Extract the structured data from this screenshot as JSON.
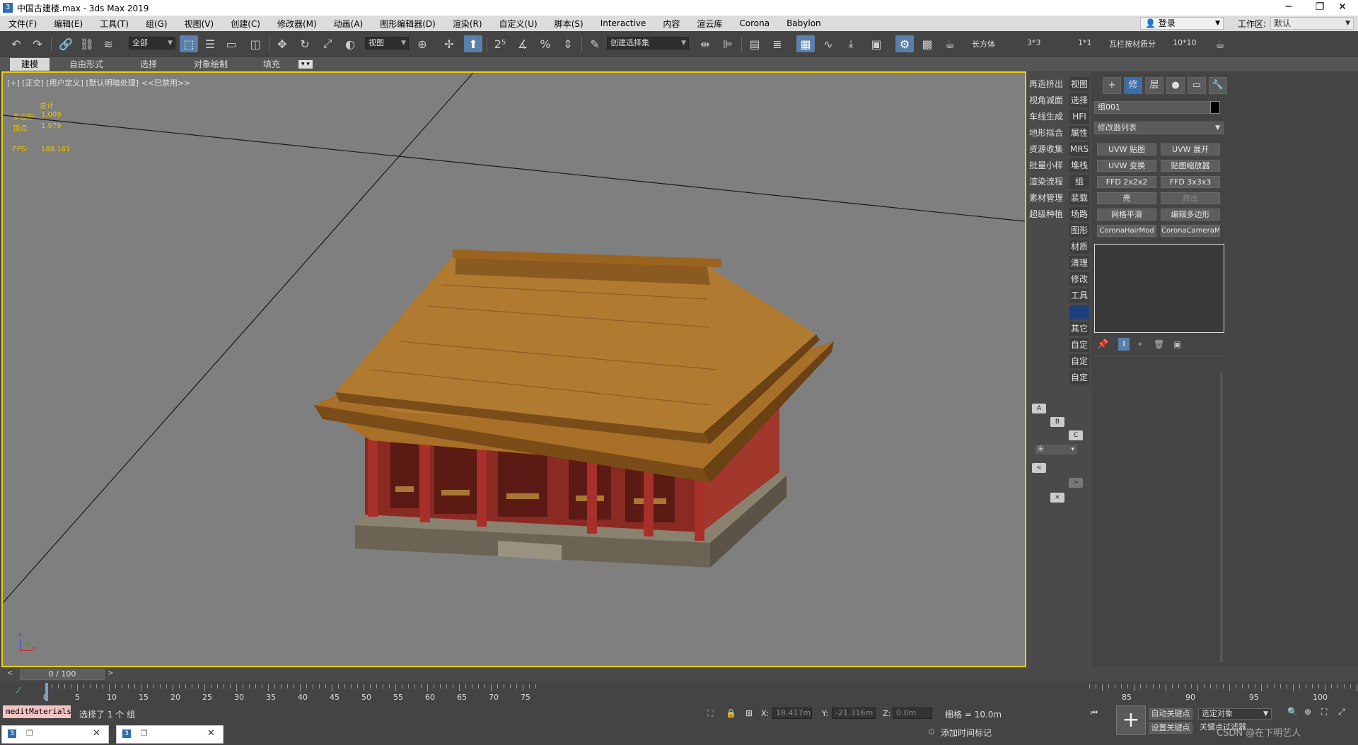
{
  "window": {
    "title": "中国古建楼.max - 3ds Max 2019",
    "app_icon": "3",
    "minimize_label": "─",
    "restore_label": "❐"
  },
  "menu": [
    "文件(F)",
    "编辑(E)",
    "工具(T)",
    "组(G)",
    "视图(V)",
    "创建(C)",
    "修改器(M)",
    "动画(A)",
    "图形编辑器(D)",
    "渲染(R)",
    "自定义(U)",
    "脚本(S)",
    "Interactive",
    "内容",
    "渲云库",
    "Corona",
    "Babylon"
  ],
  "account": {
    "login_label": "登录",
    "workspace_label": "工作区:",
    "workspace_value": "默认"
  },
  "toolbar": {
    "filter_value": "全部",
    "ref_coord_value": "视图",
    "selection_set_value": "创建选择集",
    "shortcuts": [
      "长方体",
      "3*3",
      "1*1",
      "瓦栏按材质分",
      "10*10"
    ]
  },
  "ribbon_tabs": [
    "建模",
    "自由形式",
    "选择",
    "对象绘制",
    "填充"
  ],
  "viewport": {
    "label": "[+] [正交] [用户定义] [默认明暗处理] <<已禁用>>",
    "stats_header": "总计",
    "polygons_label": "多边形:",
    "polygons_value": "1,009",
    "vertices_label": "顶点:",
    "vertices_value": "1,979",
    "fps_label": "FPS:",
    "fps_value": "188.161",
    "axis_z": "z",
    "axis_y": "y",
    "axis_x": "x"
  },
  "command_strip": {
    "left": [
      "再造挤出",
      "视角减面",
      "车线生成",
      "地形拟合",
      "资源收集",
      "批量小样",
      "渲染流程",
      "素材管理",
      "超级种植"
    ],
    "right": [
      "视图",
      "选择",
      "HFI",
      "属性",
      "MRS",
      "堆栈",
      "组",
      "装载",
      "场路",
      "图形",
      "材质",
      "清理",
      "修改",
      "工具",
      "",
      "其它",
      "自定",
      "自定",
      "自定"
    ],
    "small_buttons": [
      "A",
      "B",
      "C",
      "米",
      "<",
      ">",
      "×"
    ]
  },
  "command_panel": {
    "tabs": [
      "+",
      "修",
      "层",
      "●",
      "▭",
      "🔧"
    ],
    "object_name": "组001",
    "modifier_list": "修改器列表",
    "modifier_buttons": [
      "UVW 贴图",
      "UVW 展开",
      "UVW 变换",
      "贴图缩放器",
      "FFD 2x2x2",
      "FFD 3x3x3",
      "壳",
      "挤出",
      "网格平滑",
      "编辑多边形",
      "CoronaHairMod",
      "CoronaCameraMod"
    ],
    "accent_color": "#1f3f7a"
  },
  "timeline": {
    "frame_display": "0 / 100",
    "ticks": [
      "0",
      "5",
      "10",
      "15",
      "20",
      "25",
      "30",
      "35",
      "40",
      "45",
      "50",
      "55",
      "60",
      "65",
      "70",
      "75"
    ],
    "right_ticks": [
      "85",
      "90",
      "95",
      "100"
    ]
  },
  "status": {
    "script_label": "meditMaterials",
    "selection_text": "选择了 1 个 组",
    "x_label": "X:",
    "x_value": "18.417m",
    "y_label": "Y:",
    "y_value": "-21.316m",
    "z_label": "Z:",
    "z_value": "0.0m",
    "grid_text": "栅格 = 10.0m",
    "add_time_tag": "添加时间标记",
    "auto_key": "自动关键点",
    "set_key": "设置关键点",
    "key_filter_value": "选定对象",
    "key_filter_button": "关键点过滤器...",
    "watermark": "CSDN @在下明艺人"
  }
}
